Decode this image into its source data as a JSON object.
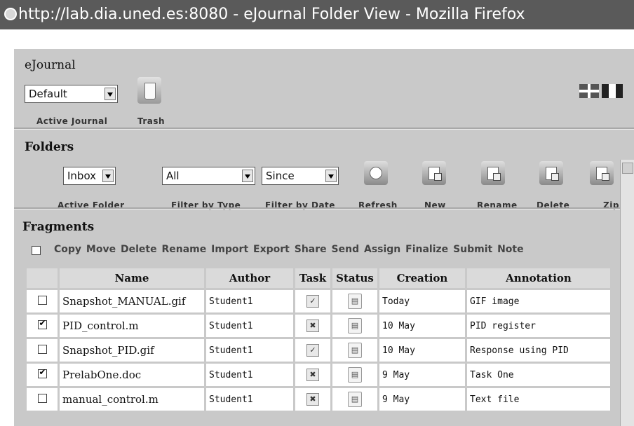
{
  "window": {
    "title": "http://lab.dia.uned.es:8080 - eJournal Folder View - Mozilla Firefox"
  },
  "journal": {
    "heading": "eJournal",
    "selected": "Default",
    "caption": "Active Journal",
    "trash_label": "Trash"
  },
  "folders": {
    "heading": "Folders",
    "folder_select": "Inbox",
    "folder_caption": "Active Folder",
    "type_select": "All",
    "type_caption": "Filter by Type",
    "date_select": "Since",
    "date_caption": "Filter by Date",
    "buttons": [
      "Refresh",
      "New",
      "Rename",
      "Delete",
      "Zip"
    ]
  },
  "fragments": {
    "heading": "Fragments",
    "actions": [
      "Copy",
      "Move",
      "Delete",
      "Rename",
      "Import",
      "Export",
      "Share",
      "Send",
      "Assign",
      "Finalize",
      "Submit",
      "Note"
    ],
    "columns": [
      "Name",
      "Author",
      "Task",
      "Status",
      "Creation",
      "Annotation"
    ],
    "rows": [
      {
        "checked": false,
        "name": "Snapshot_MANUAL.gif",
        "author": "Student1",
        "task": "check-doc-icon",
        "creation": "Today",
        "annotation": "GIF image"
      },
      {
        "checked": true,
        "name": "PID_control.m",
        "author": "Student1",
        "task": "cross-doc-icon",
        "creation": "10 May",
        "annotation": "PID register"
      },
      {
        "checked": false,
        "name": "Snapshot_PID.gif",
        "author": "Student1",
        "task": "check-doc-icon",
        "creation": "10 May",
        "annotation": "Response using PID"
      },
      {
        "checked": true,
        "name": "PrelabOne.doc",
        "author": "Student1",
        "task": "cross-doc-icon",
        "creation": "9 May",
        "annotation": "Task One"
      },
      {
        "checked": false,
        "name": "manual_control.m",
        "author": "Student1",
        "task": "cross-doc-icon",
        "creation": "9 May",
        "annotation": "Text file"
      }
    ]
  },
  "colors": {
    "background": "#c9c9c9",
    "header_cell": "#dadada",
    "titlebar": "#5a5a5a"
  },
  "languages": [
    "uk-flag-icon",
    "fr-flag-icon"
  ]
}
